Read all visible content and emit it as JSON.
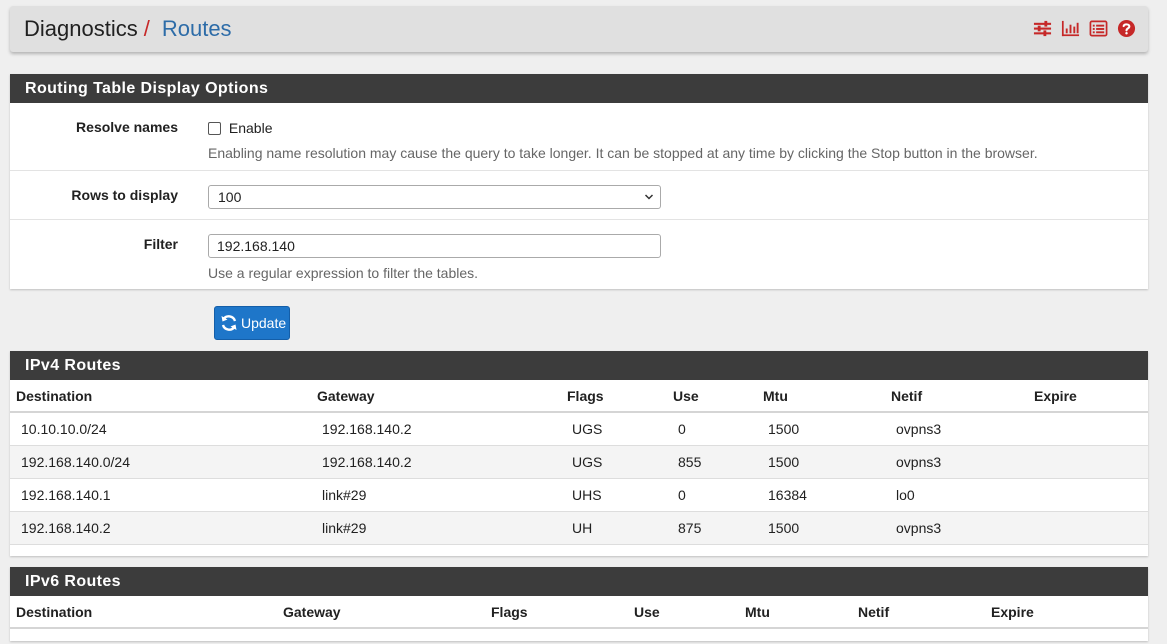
{
  "breadcrumb": {
    "base": "Diagnostics",
    "separator": "/",
    "current": "Routes"
  },
  "header_icons": [
    "sliders-icon",
    "bar-chart-icon",
    "list-icon",
    "help-icon"
  ],
  "colors": {
    "accent_red": "#c62828",
    "link_blue": "#2d6ca8",
    "panel_heading": "#3c3c3c",
    "button_blue": "#1e76c9"
  },
  "options_panel": {
    "title": "Routing Table Display Options",
    "resolve": {
      "label": "Resolve names",
      "checkbox_label": "Enable",
      "checked": false,
      "help": "Enabling name resolution may cause the query to take longer. It can be stopped at any time by clicking the Stop button in the browser."
    },
    "rows": {
      "label": "Rows to display",
      "value": "100"
    },
    "filter": {
      "label": "Filter",
      "value": "192.168.140",
      "help": "Use a regular expression to filter the tables."
    }
  },
  "update_button": {
    "label": "Update"
  },
  "ipv4": {
    "title": "IPv4 Routes",
    "columns": [
      "Destination",
      "Gateway",
      "Flags",
      "Use",
      "Mtu",
      "Netif",
      "Expire"
    ],
    "rows": [
      [
        "10.10.10.0/24",
        "192.168.140.2",
        "UGS",
        "0",
        "1500",
        "ovpns3",
        ""
      ],
      [
        "192.168.140.0/24",
        "192.168.140.2",
        "UGS",
        "855",
        "1500",
        "ovpns3",
        ""
      ],
      [
        "192.168.140.1",
        "link#29",
        "UHS",
        "0",
        "16384",
        "lo0",
        ""
      ],
      [
        "192.168.140.2",
        "link#29",
        "UH",
        "875",
        "1500",
        "ovpns3",
        ""
      ]
    ]
  },
  "ipv6": {
    "title": "IPv6 Routes",
    "columns": [
      "Destination",
      "Gateway",
      "Flags",
      "Use",
      "Mtu",
      "Netif",
      "Expire"
    ],
    "rows": []
  }
}
